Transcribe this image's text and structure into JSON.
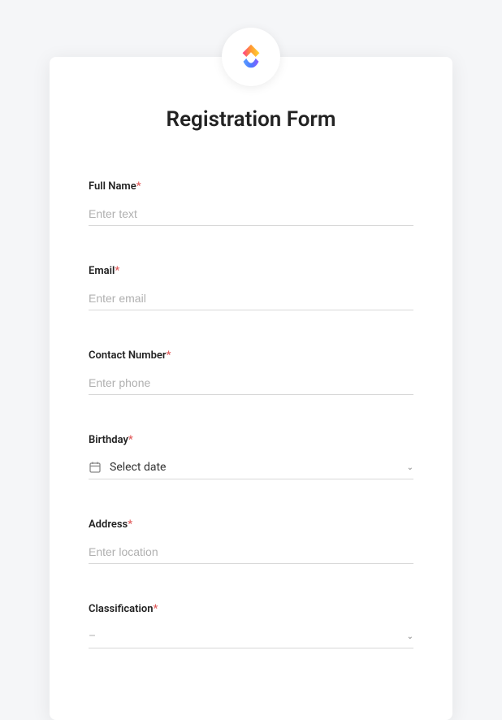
{
  "form": {
    "title": "Registration Form",
    "fields": {
      "fullName": {
        "label": "Full Name",
        "placeholder": "Enter text",
        "required": true
      },
      "email": {
        "label": "Email",
        "placeholder": "Enter email",
        "required": true
      },
      "contactNumber": {
        "label": "Contact Number",
        "placeholder": "Enter phone",
        "required": true
      },
      "birthday": {
        "label": "Birthday",
        "placeholder": "Select date",
        "required": true
      },
      "address": {
        "label": "Address",
        "placeholder": "Enter location",
        "required": true
      },
      "classification": {
        "label": "Classification",
        "placeholder": "–",
        "required": true
      }
    },
    "requiredMark": "*"
  }
}
